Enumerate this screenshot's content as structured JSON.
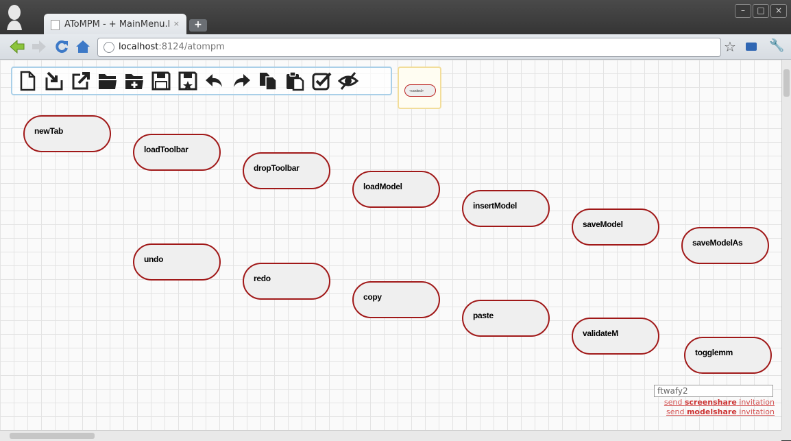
{
  "browser": {
    "tab_title": "AToMPM - + MainMenu.l",
    "tab_close": "×",
    "new_tab": "+",
    "url_host": "localhost",
    "url_rest": ":8124/atompm",
    "window_buttons": [
      "–",
      "□",
      "×"
    ]
  },
  "toolbar": {
    "icons": [
      "new-file-icon",
      "load-toolbar-icon",
      "open-external-icon",
      "open-folder-icon",
      "folder-add-icon",
      "save-icon",
      "save-as-icon",
      "undo-icon",
      "redo-icon",
      "copy-icon",
      "paste-icon",
      "validate-icon",
      "toggle-visibility-icon"
    ]
  },
  "coded_panel": {
    "label": "«coded»"
  },
  "buttons": {
    "newTab": "newTab",
    "loadToolbar": "loadToolbar",
    "dropToolbar": "dropToolbar",
    "loadModel": "loadModel",
    "insertModel": "insertModel",
    "saveModel": "saveModel",
    "saveModelAs": "saveModelAs",
    "undo": "undo",
    "redo": "redo",
    "copy": "copy",
    "paste": "paste",
    "validateM": "validateM",
    "togglemm": "togglemm"
  },
  "share": {
    "value": "ftwafy2",
    "screenshare_pre": "send ",
    "screenshare_bold": "screenshare",
    "screenshare_post": " invitation",
    "modelshare_pre": "send ",
    "modelshare_bold": "modelshare",
    "modelshare_post": " invitation"
  },
  "colors": {
    "pill_border": "#a01818",
    "pill_fill": "#efefef",
    "link": "#d45555"
  }
}
